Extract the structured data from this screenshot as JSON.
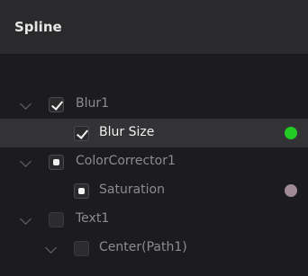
{
  "panel": {
    "title": "Spline"
  },
  "tree": {
    "items": [
      {
        "label": "Blur1",
        "check": "checked",
        "expanded": true
      },
      {
        "label": "Blur Size",
        "check": "checked",
        "dot_color": "#22cc22"
      },
      {
        "label": "ColorCorrector1",
        "check": "partial",
        "expanded": true
      },
      {
        "label": "Saturation",
        "check": "partial",
        "dot_color": "#a08a96"
      },
      {
        "label": "Text1",
        "check": "empty",
        "expanded": true
      },
      {
        "label": "Center(Path1)",
        "check": "empty",
        "expanded": true
      }
    ]
  }
}
